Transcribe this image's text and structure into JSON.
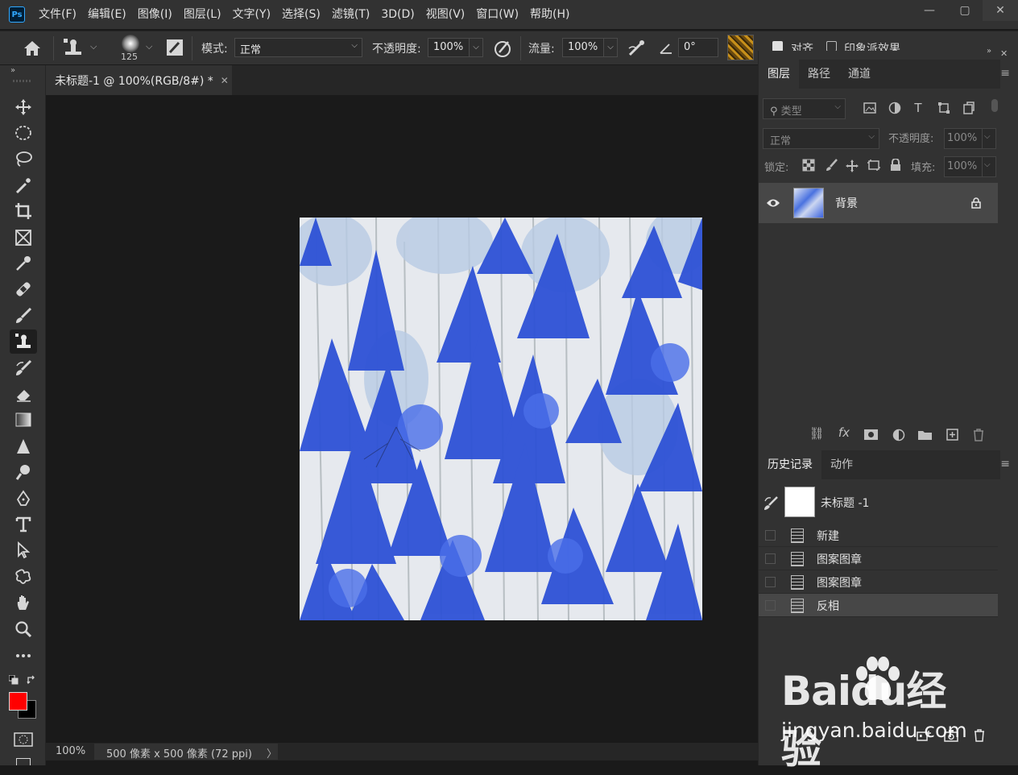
{
  "app": {
    "logo_text": "Ps",
    "menu": [
      "文件(F)",
      "编辑(E)",
      "图像(I)",
      "图层(L)",
      "文字(Y)",
      "选择(S)",
      "滤镜(T)",
      "3D(D)",
      "视图(V)",
      "窗口(W)",
      "帮助(H)"
    ],
    "window_controls": {
      "minimize": "—",
      "maximize": "▢",
      "close": "✕"
    }
  },
  "options": {
    "brush_size": "125",
    "mode_label": "模式:",
    "mode_value": "正常",
    "opacity_label": "不透明度:",
    "opacity_value": "100%",
    "flow_label": "流量:",
    "flow_value": "100%",
    "angle_value": "0°",
    "align_label": "对齐",
    "impressionist_label": "印象派效果"
  },
  "document": {
    "tab_title": "未标题-1 @ 100%(RGB/8#) *",
    "close_glyph": "✕"
  },
  "status": {
    "zoom": "100%",
    "info": "500 像素 x 500 像素 (72 ppi)",
    "arrow": "〉"
  },
  "layers_panel": {
    "tabs": [
      "图层",
      "路径",
      "通道"
    ],
    "filter_placeholder": "类型",
    "blend_mode": "正常",
    "opacity_label": "不透明度:",
    "opacity_value": "100%",
    "lock_label": "锁定:",
    "fill_label": "填充:",
    "fill_value": "100%",
    "layers": [
      {
        "name": "背景",
        "visible": true,
        "locked": true
      }
    ]
  },
  "history_panel": {
    "tabs": [
      "历史记录",
      "动作"
    ],
    "snapshot_name": "未标题 -1",
    "items": [
      {
        "label": "新建",
        "active": false
      },
      {
        "label": "图案图章",
        "active": false
      },
      {
        "label": "图案图章",
        "active": false
      },
      {
        "label": "反相",
        "active": true
      }
    ]
  },
  "colors": {
    "foreground": "#ff0000",
    "background": "#000000",
    "accent": "#31a8ff"
  },
  "watermark": {
    "brand": "Baidu经验",
    "url": "jingyan.baidu.com"
  }
}
